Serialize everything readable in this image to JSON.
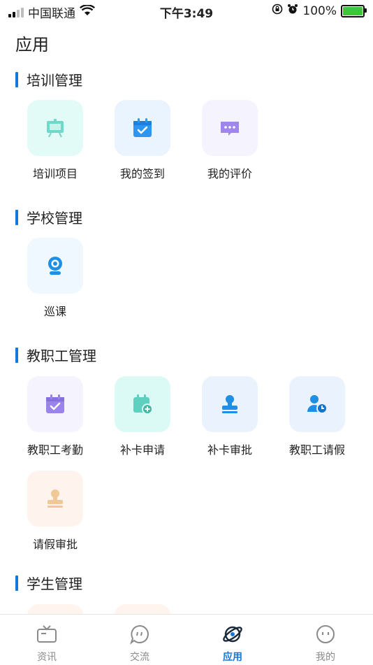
{
  "status_bar": {
    "carrier": "中国联通",
    "time": "下午3:49",
    "battery": "100%"
  },
  "page": {
    "title": "应用"
  },
  "colors": {
    "accent": "#1677d9",
    "active_tab": "#1677d9",
    "inactive_tab": "#8a8a8a"
  },
  "sections": {
    "training": {
      "title": "培训管理",
      "items": [
        {
          "label": "培训项目",
          "icon": "presentation-board-icon"
        },
        {
          "label": "我的签到",
          "icon": "calendar-check-icon"
        },
        {
          "label": "我的评价",
          "icon": "chat-bubble-icon"
        }
      ]
    },
    "school": {
      "title": "学校管理",
      "items": [
        {
          "label": "巡课",
          "icon": "webcam-icon"
        }
      ]
    },
    "staff": {
      "title": "教职工管理",
      "items": [
        {
          "label": "教职工考勤",
          "icon": "calendar-check-icon"
        },
        {
          "label": "补卡申请",
          "icon": "calendar-add-icon"
        },
        {
          "label": "补卡审批",
          "icon": "stamp-icon"
        },
        {
          "label": "教职工请假",
          "icon": "user-clock-icon"
        },
        {
          "label": "请假审批",
          "icon": "stamp-icon"
        }
      ]
    },
    "student": {
      "title": "学生管理"
    }
  },
  "tabbar": {
    "tabs": [
      {
        "label": "资讯",
        "icon": "tv-icon"
      },
      {
        "label": "交流",
        "icon": "chat-icon"
      },
      {
        "label": "应用",
        "icon": "planet-icon",
        "active": true
      },
      {
        "label": "我的",
        "icon": "face-icon"
      }
    ]
  }
}
